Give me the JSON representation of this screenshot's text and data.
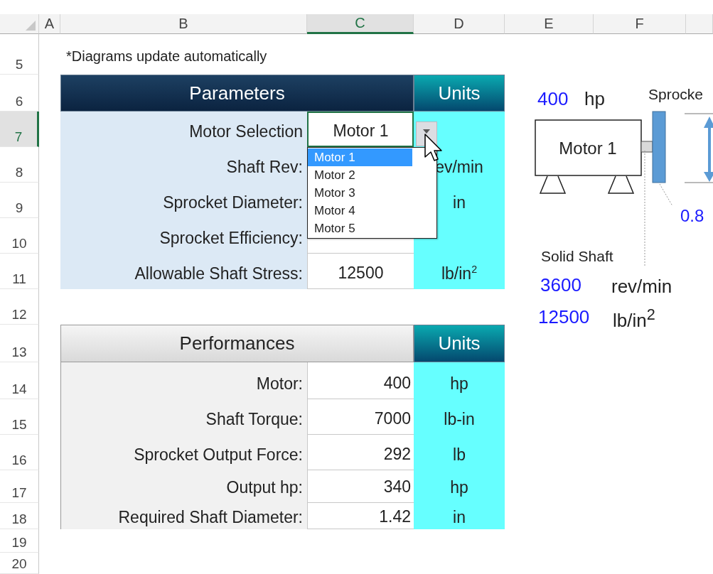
{
  "column_headers": [
    {
      "label": "A",
      "selected": false
    },
    {
      "label": "B",
      "selected": false
    },
    {
      "label": "C",
      "selected": true
    },
    {
      "label": "D",
      "selected": false
    },
    {
      "label": "E",
      "selected": false
    },
    {
      "label": "F",
      "selected": false
    }
  ],
  "row_numbers": [
    {
      "label": "5",
      "selected": false
    },
    {
      "label": "6",
      "selected": false
    },
    {
      "label": "7",
      "selected": true
    },
    {
      "label": "8",
      "selected": false
    },
    {
      "label": "9",
      "selected": false
    },
    {
      "label": "10",
      "selected": false
    },
    {
      "label": "11",
      "selected": false
    },
    {
      "label": "12",
      "selected": false
    },
    {
      "label": "13",
      "selected": false
    },
    {
      "label": "14",
      "selected": false
    },
    {
      "label": "15",
      "selected": false
    },
    {
      "label": "16",
      "selected": false
    },
    {
      "label": "17",
      "selected": false
    },
    {
      "label": "18",
      "selected": false
    },
    {
      "label": "19",
      "selected": false
    },
    {
      "label": "20",
      "selected": false
    }
  ],
  "note": "*Diagrams update automatically",
  "parameters": {
    "title": "Parameters",
    "units_title": "Units",
    "rows": [
      {
        "label": "Motor Selection",
        "value": "Motor 1",
        "active": true
      },
      {
        "label": "Shaft Rev:",
        "unit": "ev/min"
      },
      {
        "label": "Sprocket Diameter:",
        "unit": "in"
      },
      {
        "label": "Sprocket Efficiency:"
      },
      {
        "label": "Allowable Shaft Stress:",
        "value": "12500",
        "unit": "lb/in$^{2}$"
      }
    ]
  },
  "dropdown": {
    "options": [
      {
        "label": "Motor 1",
        "selected": true
      },
      {
        "label": "Motor 2",
        "selected": false
      },
      {
        "label": "Motor 3",
        "selected": false
      },
      {
        "label": "Motor 4",
        "selected": false
      },
      {
        "label": "Motor 5",
        "selected": false
      }
    ]
  },
  "performances": {
    "title": "Performances",
    "units_title": "Units",
    "rows": [
      {
        "label": "Motor:",
        "value": "400",
        "unit": "hp"
      },
      {
        "label": "Shaft Torque:",
        "value": "7000",
        "unit": "lb-in"
      },
      {
        "label": "Sprocket Output Force:",
        "value": "292",
        "unit": "lb"
      },
      {
        "label": "Output hp:",
        "value": "340",
        "unit": "hp"
      },
      {
        "label": "Required Shaft Diameter:",
        "value": "1.42",
        "unit": "in"
      }
    ]
  },
  "diagram": {
    "power": "400",
    "power_unit": "hp",
    "sprocket_label": "Sprocke",
    "motor_label": "Motor 1",
    "efficiency": "0.8",
    "shaft_label": "Solid Shaft",
    "speed": "3600",
    "speed_unit": "rev/min",
    "stress": "12500",
    "stress_unit": "lb/in$^{2}$"
  }
}
